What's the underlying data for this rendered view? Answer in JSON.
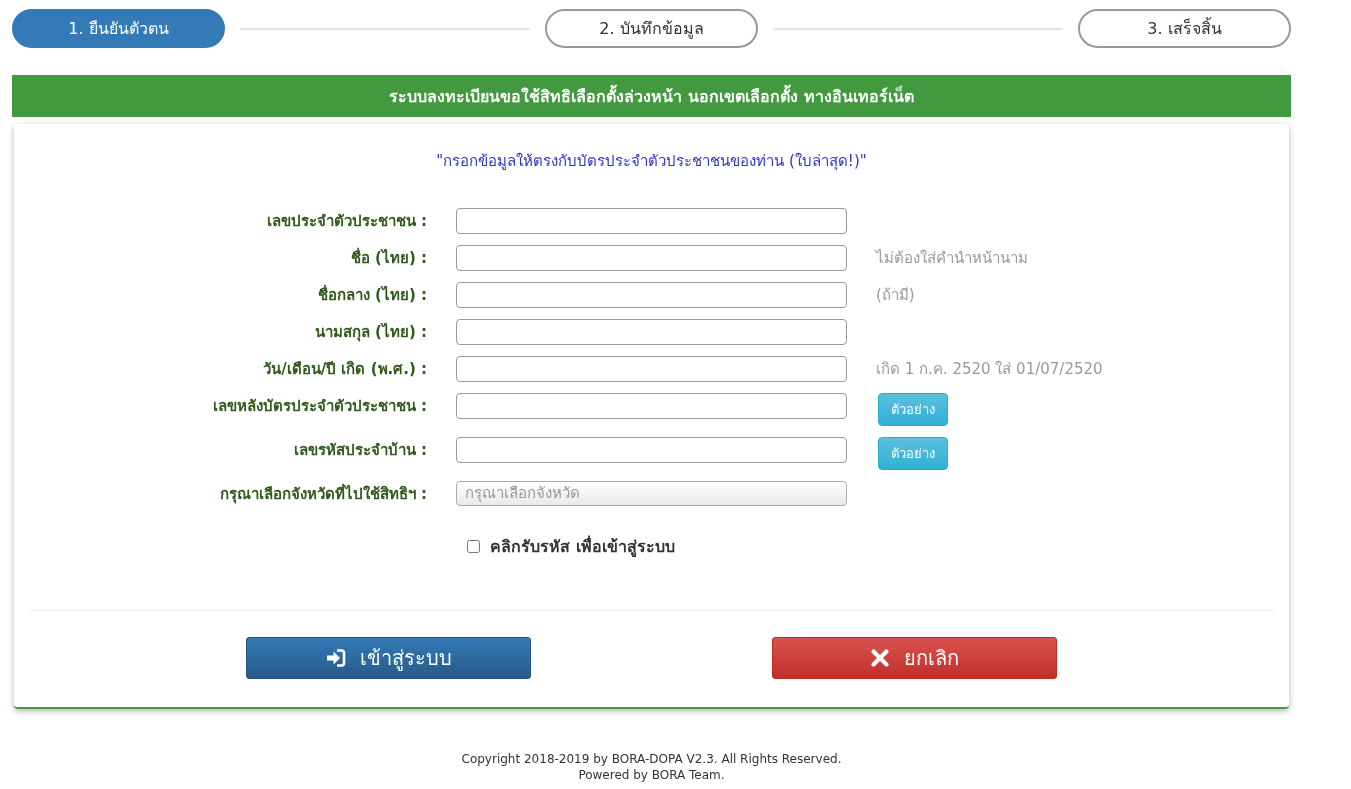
{
  "steps": [
    {
      "label": "1. ยืนยันตัวตน",
      "selected": true
    },
    {
      "label": "2. บันทึกข้อมูล",
      "selected": false
    },
    {
      "label": "3. เสร็จสิ้น",
      "selected": false
    }
  ],
  "banner": {
    "title": "ระบบลงทะเบียนขอใช้สิทธิเลือกตั้งล่วงหน้า นอกเขตเลือกตั้ง ทางอินเทอร์เน็ต"
  },
  "form": {
    "notice": "\"กรอกข้อมูลให้ตรงกับบัตรประจำตัวประชาชนของท่าน (ใบล่าสุด!)\"",
    "fields": [
      {
        "kind": "text",
        "label": "เลขประจำตัวประชาชน :"
      },
      {
        "kind": "text",
        "label": "ชื่อ (ไทย) :",
        "hint": "ไม่ต้องใส่คำนำหน้านาม"
      },
      {
        "kind": "text",
        "label": "ชื่อกลาง (ไทย) :",
        "hint": "(ถ้ามี)"
      },
      {
        "kind": "text",
        "label": "นามสกุล (ไทย) :"
      },
      {
        "kind": "text",
        "label": "วัน/เดือน/ปี เกิด (พ.ศ.) :",
        "hint": "เกิด 1 ก.ค. 2520 ใส่ 01/07/2520"
      },
      {
        "kind": "text",
        "label": "เลขหลังบัตรประจำตัวประชาชน :",
        "button": "ตัวอย่าง"
      },
      {
        "kind": "text",
        "label": "เลขรหัสประจำบ้าน :",
        "button": "ตัวอย่าง"
      },
      {
        "kind": "select",
        "label": "กรุณาเลือกจังหวัดที่ไปใช้สิทธิฯ :",
        "placeholder": "กรุณาเลือกจังหวัด"
      }
    ],
    "consent": {
      "label": "คลิกรับรหัส เพื่อเข้าสู่ระบบ",
      "checked": false
    }
  },
  "actions": [
    {
      "kind": "login",
      "label": "เข้าสู่ระบบ"
    },
    {
      "kind": "cancel",
      "label": "ยกเลิก"
    }
  ],
  "footer": [
    "Copyright 2018-2019 by BORA-DOPA V2.3. All Rights Reserved.",
    "Powered by BORA Team."
  ]
}
